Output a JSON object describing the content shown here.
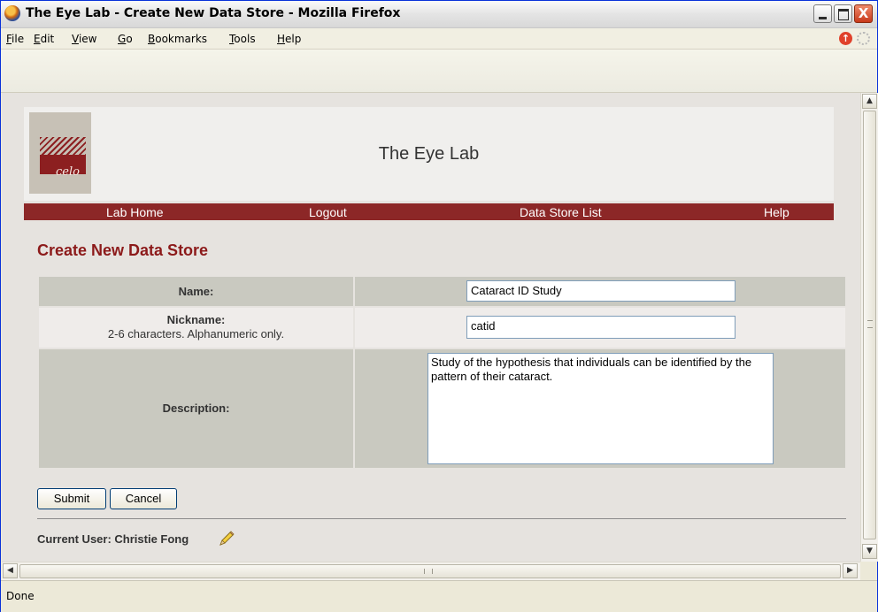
{
  "window": {
    "title": "The Eye Lab - Create New Data Store - Mozilla Firefox",
    "controls": {
      "minimize": "_",
      "maximize": "□",
      "close": "X"
    }
  },
  "menubar": {
    "items": [
      {
        "label": "File",
        "key": "F",
        "rest": "ile"
      },
      {
        "label": "Edit",
        "key": "E",
        "rest": "dit"
      },
      {
        "label": "View",
        "key": "V",
        "rest": "iew"
      },
      {
        "label": "Go",
        "key": "G",
        "rest": "o"
      },
      {
        "label": "Bookmarks",
        "key": "B",
        "rest": "ookmarks"
      },
      {
        "label": "Tools",
        "key": "T",
        "rest": "ools"
      },
      {
        "label": "Help",
        "key": "H",
        "rest": "elp"
      }
    ]
  },
  "site": {
    "logo_text": "celo",
    "title": "The Eye Lab",
    "nav": [
      "Lab Home",
      "Logout",
      "Data Store List",
      "Help"
    ]
  },
  "form": {
    "heading": "Create New Data Store",
    "name_label": "Name:",
    "name_value": "Cataract ID Study",
    "nickname_label": "Nickname:",
    "nickname_hint": "2-6 characters. Alphanumeric only.",
    "nickname_value": "catid",
    "description_label": "Description:",
    "description_value": "Study of the hypothesis that individuals can be identified by the pattern of their cataract.",
    "submit_label": "Submit",
    "cancel_label": "Cancel"
  },
  "footer": {
    "current_user": "Current User: Christie Fong"
  },
  "status": {
    "text": "Done"
  },
  "colors": {
    "accent": "#8c2727",
    "heading": "#8c1a1a",
    "row_dark": "#c9c9c0",
    "row_light": "#efecea"
  },
  "icons": [
    "firefox-icon",
    "stop-icon",
    "throbber-icon",
    "pencil-icon",
    "scroll-up-icon",
    "scroll-down-icon",
    "scroll-left-icon",
    "scroll-right-icon"
  ]
}
